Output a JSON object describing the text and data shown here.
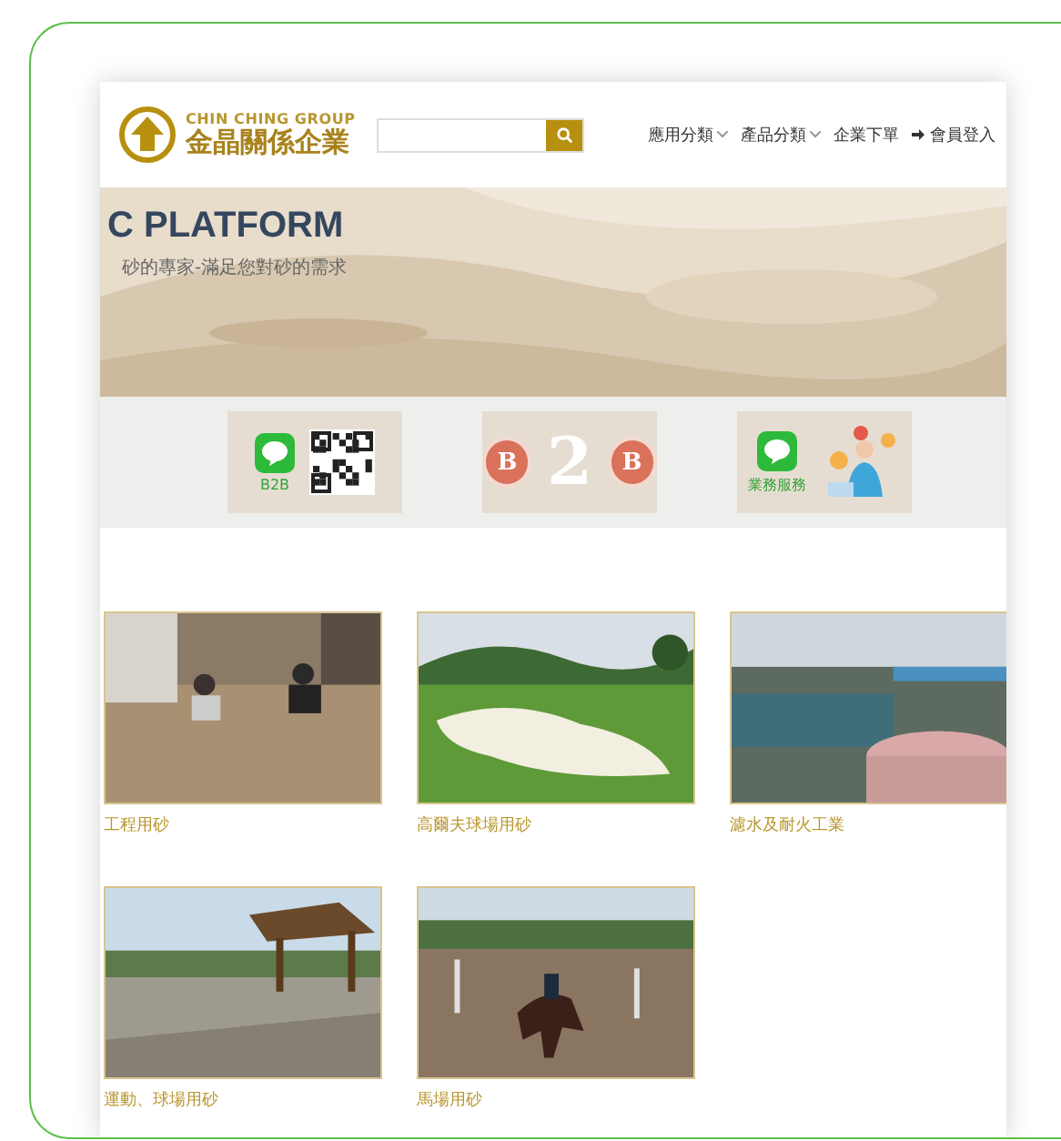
{
  "header": {
    "brand_en": "CHIN CHING GROUP",
    "brand_zh": "金晶關係企業",
    "nav": [
      {
        "kind": "menu",
        "label": "應用分類",
        "dropdown": true
      },
      {
        "kind": "menu",
        "label": "產品分類",
        "dropdown": true
      },
      {
        "kind": "link",
        "label": "企業下單",
        "dropdown": false
      },
      {
        "kind": "login",
        "label": "會員登入",
        "dropdown": false
      }
    ]
  },
  "hero": {
    "title": "C PLATFORM",
    "subtitle": "砂的專家-滿足您對砂的需求"
  },
  "promos": [
    {
      "kind": "line-qr",
      "caption": "B2B"
    },
    {
      "kind": "b2b",
      "letters": [
        "B",
        "2",
        "B"
      ]
    },
    {
      "kind": "line-people",
      "caption": "業務服務"
    }
  ],
  "gallery": [
    {
      "caption": "工程用砂",
      "kind": "picture"
    },
    {
      "caption": "高爾夫球場用砂",
      "kind": "picture"
    },
    {
      "caption": "濾水及耐火工業",
      "kind": "picture"
    },
    {
      "caption": "運動、球場用砂",
      "kind": "picture"
    },
    {
      "caption": "馬場用砂",
      "kind": "picture"
    }
  ]
}
